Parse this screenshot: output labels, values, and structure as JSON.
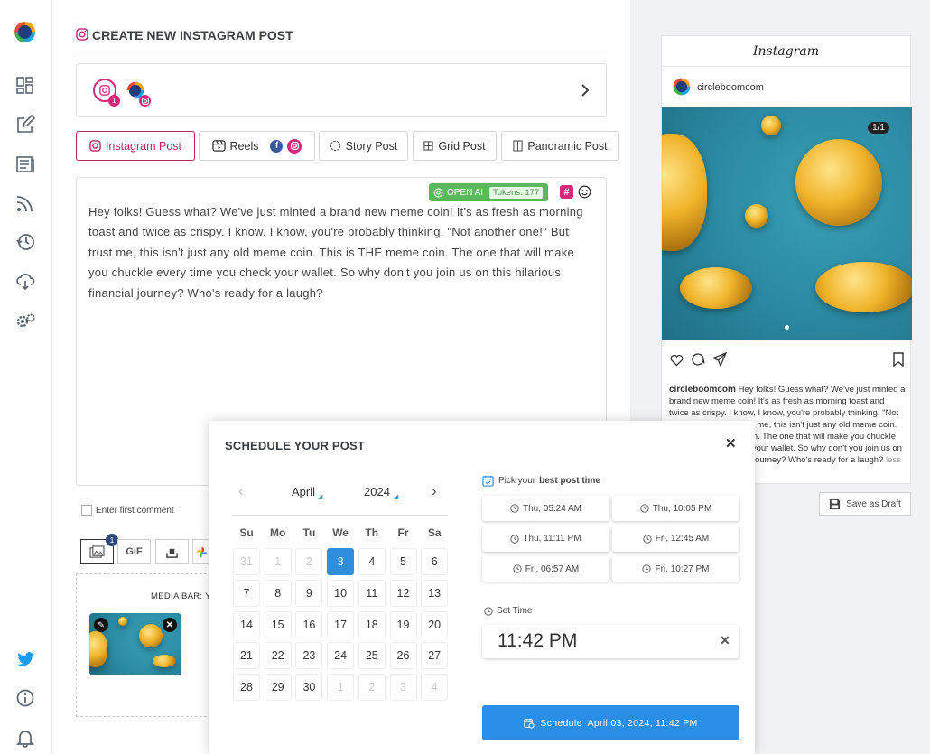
{
  "sidebar": {
    "items": [
      "dashboard-icon",
      "compose-icon",
      "posts-icon",
      "rss-icon",
      "history-icon",
      "cloud-icon",
      "settings-icon"
    ],
    "bottom": [
      "twitter-icon",
      "info-icon",
      "bell-icon"
    ]
  },
  "editor": {
    "title": "CREATE NEW INSTAGRAM POST",
    "account_badge": "1",
    "tabs": [
      {
        "label": "Instagram Post"
      },
      {
        "label": "Reels"
      },
      {
        "label": "Story Post"
      },
      {
        "label": "Grid Post"
      },
      {
        "label": "Panoramic Post"
      }
    ],
    "openai_label": "OPEN AI",
    "tokens_label": "Tokens: 177",
    "post_text": "Hey folks! Guess what? We've just minted a brand new meme coin! It's as fresh as morning toast and twice as crispy. I know, I know, you're probably thinking, \"Not another one!\" But trust me, this isn't just any old meme coin. This is THE meme coin. The one that will make you chuckle every time you check your wallet. So why don't you join us on this hilarious financial journey? Who's ready for a laugh?",
    "first_comment_placeholder": "Enter first comment",
    "media_badge": "1",
    "gif_label": "GIF",
    "media_bar_label": "MEDIA BAR: YO"
  },
  "preview": {
    "app_name": "Instagram",
    "username": "circleboomcom",
    "counter": "1/1",
    "caption_user": "circleboomcom",
    "caption_text": "Hey folks! Guess what? We've just minted a brand new meme coin! It's as fresh as morning toast and twice as crispy. I know, I know, you're probably thinking, \"Not another one!\" But trust me, this isn't just any old meme coin. This is THE meme coin. The one that will make you chuckle every time you check your wallet. So why don't you join us on this hilarious financial journey? Who's ready for a laugh?",
    "less_label": "less",
    "draft_label": "Save as Draft"
  },
  "schedule": {
    "title": "SCHEDULE YOUR POST",
    "month": "April",
    "year": "2024",
    "weekdays": [
      "Su",
      "Mo",
      "Tu",
      "We",
      "Th",
      "Fr",
      "Sa"
    ],
    "weeks": [
      [
        "31",
        "1",
        "2",
        "3",
        "4",
        "5",
        "6"
      ],
      [
        "7",
        "8",
        "9",
        "10",
        "11",
        "12",
        "13"
      ],
      [
        "14",
        "15",
        "16",
        "17",
        "18",
        "19",
        "20"
      ],
      [
        "21",
        "22",
        "23",
        "24",
        "25",
        "26",
        "27"
      ],
      [
        "28",
        "29",
        "30",
        "1",
        "2",
        "3",
        "4"
      ]
    ],
    "best_time_prefix": "Pick your",
    "best_time_bold": "best post time",
    "best_times": [
      "Thu, 05:24 AM",
      "Thu, 10:05 PM",
      "Thu, 11:11 PM",
      "Fri, 12:45 AM",
      "Fri, 06:57 AM",
      "Fri, 10:27 PM"
    ],
    "set_time_label": "Set Time",
    "time_value": "11:42 PM",
    "button_label": "Schedule",
    "button_date": "April 03, 2024, 11:42 PM"
  }
}
